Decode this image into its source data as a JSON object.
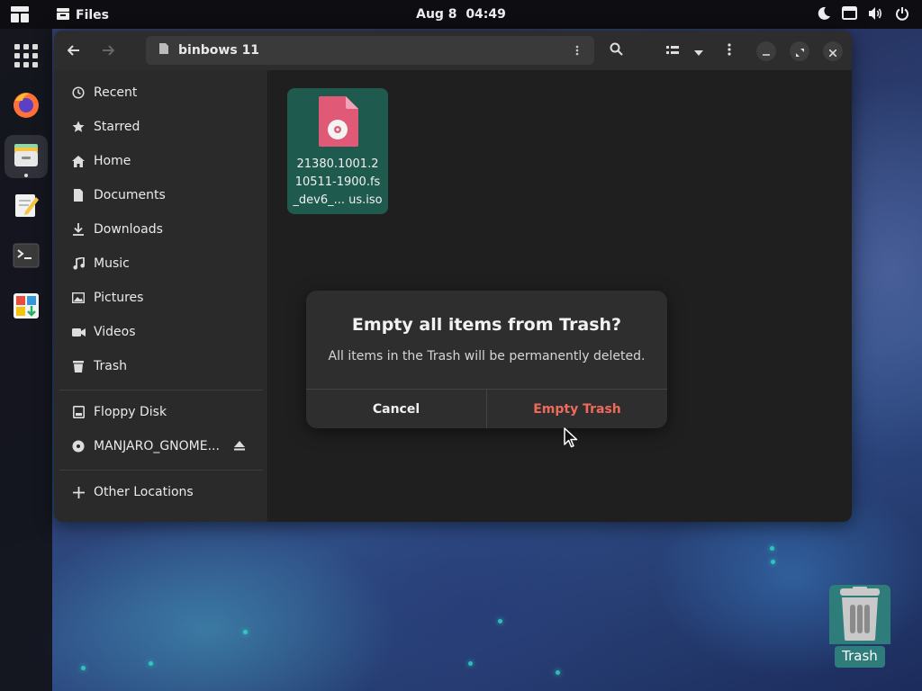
{
  "topbar": {
    "app_name": "Files",
    "date": "Aug 8",
    "time": "04:49"
  },
  "dock": {
    "items": [
      "app-grid",
      "firefox",
      "files",
      "text-editor",
      "terminal",
      "software"
    ]
  },
  "window": {
    "path": "binbows 11",
    "file": {
      "name_line1": "21380.1001.2",
      "name_line2": "10511-1900.fs",
      "name_line3": "_dev6_... us.iso"
    }
  },
  "sidebar": {
    "items": [
      {
        "label": "Recent"
      },
      {
        "label": "Starred"
      },
      {
        "label": "Home"
      },
      {
        "label": "Documents"
      },
      {
        "label": "Downloads"
      },
      {
        "label": "Music"
      },
      {
        "label": "Pictures"
      },
      {
        "label": "Videos"
      },
      {
        "label": "Trash"
      }
    ],
    "devices": [
      {
        "label": "Floppy Disk"
      },
      {
        "label": "MANJARO_GNOME..."
      }
    ],
    "other": {
      "label": "Other Locations"
    }
  },
  "dialog": {
    "title": "Empty all items from Trash?",
    "body": "All items in the Trash will be permanently deleted.",
    "cancel_label": "Cancel",
    "confirm_label": "Empty Trash"
  },
  "desktop": {
    "trash_label": "Trash"
  },
  "colors": {
    "accent_danger": "#ee6b5c",
    "selection": "#1f5a4f",
    "iso_icon": "#e05a78"
  }
}
